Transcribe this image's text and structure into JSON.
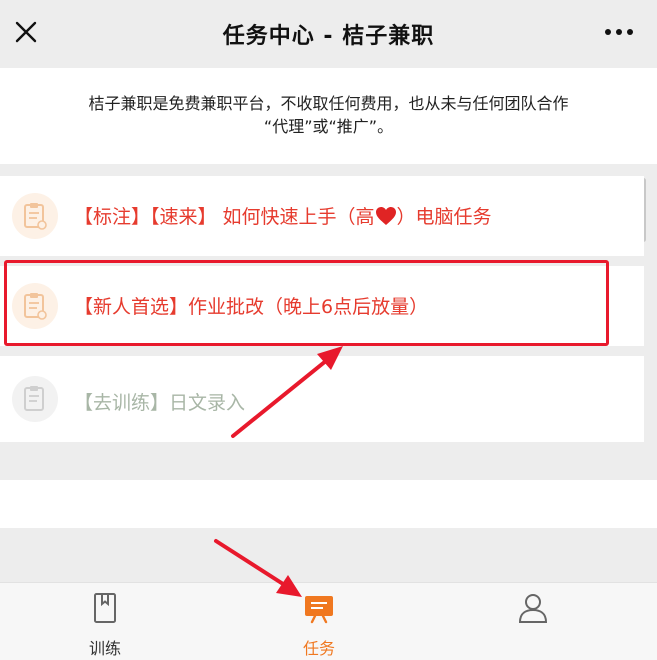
{
  "header": {
    "title": "任务中心 - 桔子兼职"
  },
  "notice": {
    "line1": "桔子兼职是免费兼职平台，不收取任何费用，也从未与任何团队合作",
    "line2": "“代理”或“推广”。"
  },
  "tasks": [
    {
      "label_before_heart": "【标注】【速来】 如何快速上手（高",
      "label_after_heart": "）电脑任务",
      "style": "red"
    },
    {
      "label": "【新人首选】作业批改（晚上6点后放量）",
      "style": "red",
      "highlighted": true
    },
    {
      "label": "【去训练】日文录入",
      "style": "dim"
    }
  ],
  "tabbar": {
    "tabs": [
      {
        "label": "训练",
        "icon": "book-icon",
        "active": false
      },
      {
        "label": "任务",
        "icon": "task-board-icon",
        "active": true
      },
      {
        "label": "",
        "icon": "person-icon",
        "active": false
      }
    ]
  },
  "colors": {
    "accent": "#f07820",
    "task_red": "#e63b2e",
    "highlight_border": "#e8192c",
    "dim_text": "#a8b6a6"
  }
}
